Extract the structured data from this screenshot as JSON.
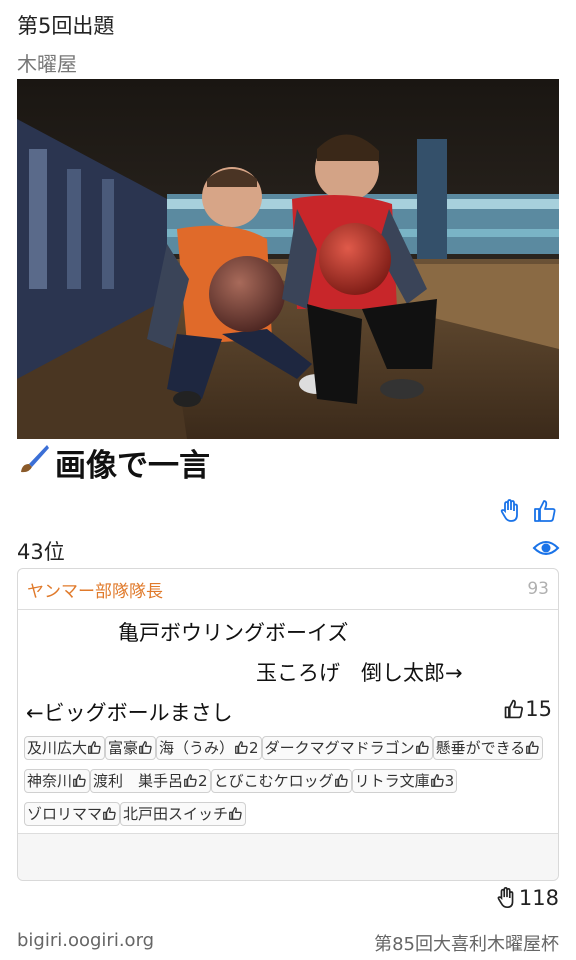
{
  "header": {
    "title": "第5回出題",
    "subtitle": "木曜屋"
  },
  "section_title": "画像で一言",
  "rank": "43位",
  "entry": {
    "author": "ヤンマー部隊隊長",
    "score": "93",
    "lines": [
      "亀戸ボウリングボーイズ",
      "玉ころげ　倒し太郎→",
      "←ビッグボールまさし"
    ],
    "likes": "15",
    "voters": [
      {
        "name": "及川広大",
        "count": ""
      },
      {
        "name": "富豪",
        "count": ""
      },
      {
        "name": "海（うみ）",
        "count": "2"
      },
      {
        "name": "ダークマグマドラゴン",
        "count": ""
      },
      {
        "name": "懸垂ができる",
        "count": ""
      },
      {
        "name": "神奈川",
        "count": ""
      },
      {
        "name": "渡利　巣手呂",
        "count": "2"
      },
      {
        "name": "とびこむケロッグ",
        "count": ""
      },
      {
        "name": "リトラ文庫",
        "count": "3"
      },
      {
        "name": "ゾロリママ",
        "count": ""
      },
      {
        "name": "北戸田スイッチ",
        "count": ""
      }
    ]
  },
  "total_votes": "118",
  "footer": {
    "site": "bigiri.oogiri.org",
    "event": "第85回大喜利木曜屋杯"
  },
  "colors": {
    "accent": "#1a73e8",
    "author": "#e07a2b"
  }
}
